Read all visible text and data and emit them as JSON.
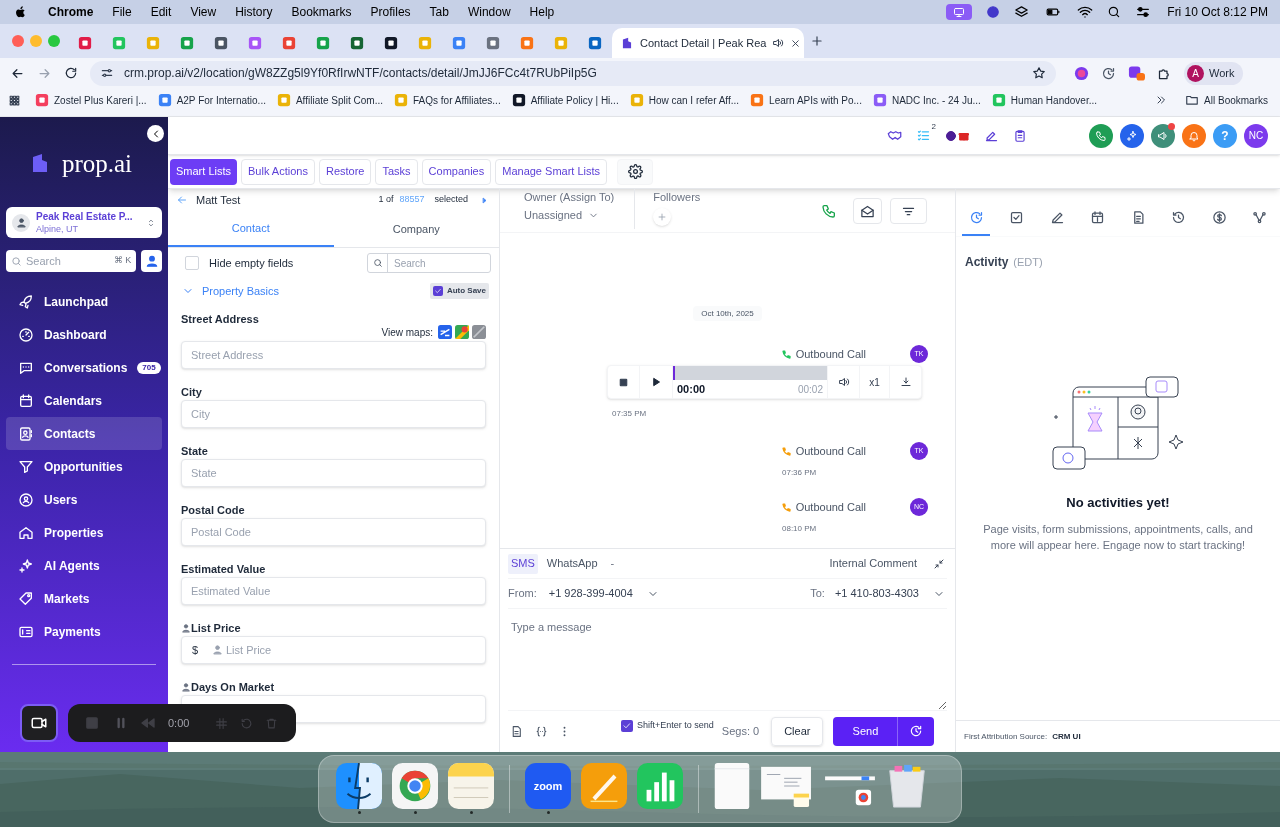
{
  "menu_bar": {
    "app": "Chrome",
    "menus": [
      "File",
      "Edit",
      "View",
      "History",
      "Bookmarks",
      "Profiles",
      "Tab",
      "Window",
      "Help"
    ],
    "clock": "Fri 10 Oct 8:12 PM"
  },
  "browser": {
    "tabs": [
      {
        "selected": false,
        "audio": false
      },
      {
        "selected": false,
        "audio": false
      },
      {
        "selected": false,
        "audio": false
      },
      {
        "selected": false,
        "audio": false
      },
      {
        "selected": false,
        "audio": false
      },
      {
        "selected": false,
        "audio": false
      },
      {
        "selected": false,
        "audio": false
      },
      {
        "selected": false,
        "audio": false
      },
      {
        "selected": false,
        "audio": false
      },
      {
        "selected": false,
        "audio": false
      },
      {
        "selected": false,
        "audio": false
      },
      {
        "selected": false,
        "audio": false
      },
      {
        "selected": false,
        "audio": false
      },
      {
        "selected": false,
        "audio": false
      },
      {
        "selected": false,
        "audio": false
      },
      {
        "selected": false,
        "audio": false
      },
      {
        "title": "Contact Detail | Peak Rea",
        "selected": true,
        "audio": true
      }
    ],
    "url": "crm.prop.ai/v2/location/gW8ZZg5l9Yf0RfIrwNTF/contacts/detail/JmJJ6FCc4t7RUbPiIp5G",
    "profile": {
      "initial": "A",
      "label": "Work"
    },
    "bookmarks": [
      "Zostel Plus Kareri |...",
      "A2P For Internatio...",
      "Affiliate Split Com...",
      "FAQs for Affiliates...",
      "Affiliate Policy | Hi...",
      "How can I refer Aff...",
      "Learn APIs with Po...",
      "NADC Inc. - 24 Ju...",
      "Human Handover..."
    ],
    "all_bookmarks": "All Bookmarks"
  },
  "sidebar": {
    "logo": "prop.ai",
    "location": {
      "name": "Peak Real Estate P...",
      "place": "Alpine, UT"
    },
    "search": {
      "placeholder": "Search",
      "shortcut": "⌘ K"
    },
    "items": [
      {
        "label": "Launchpad",
        "selected": false
      },
      {
        "label": "Dashboard",
        "selected": false
      },
      {
        "label": "Conversations",
        "selected": false,
        "badge": "705"
      },
      {
        "label": "Calendars",
        "selected": false
      },
      {
        "label": "Contacts",
        "selected": true
      },
      {
        "label": "Opportunities",
        "selected": false
      },
      {
        "label": "Users",
        "selected": false
      },
      {
        "label": "Properties",
        "selected": false
      },
      {
        "label": "AI Agents",
        "selected": false
      },
      {
        "label": "Markets",
        "selected": false
      },
      {
        "label": "Payments",
        "selected": false
      }
    ]
  },
  "header": {
    "tasks_badge": "2",
    "announcement_unread": true,
    "help": "?",
    "avatar": "NC"
  },
  "toolbar": [
    {
      "label": "Smart Lists",
      "selected": true
    },
    {
      "label": "Bulk Actions",
      "selected": false
    },
    {
      "label": "Restore",
      "selected": false
    },
    {
      "label": "Tasks",
      "selected": false
    },
    {
      "label": "Companies",
      "selected": false
    },
    {
      "label": "Manage Smart Lists",
      "selected": false
    }
  ],
  "contact": {
    "name": "Matt Test",
    "position": "1 of",
    "total": "88557",
    "selected_label": "selected",
    "tabs": [
      {
        "label": "Contact",
        "selected": true
      },
      {
        "label": "Company",
        "selected": false
      }
    ],
    "hide_empty": {
      "label": "Hide empty fields",
      "checked": false
    },
    "search": {
      "placeholder": "Search"
    },
    "section": {
      "title": "Property Basics",
      "expanded": true
    },
    "auto_save": {
      "label": "Auto Save",
      "checked": true
    },
    "fields": [
      {
        "kind": "standard",
        "label": "Street Address",
        "placeholder": "Street Address",
        "maps_label": "View maps:"
      },
      {
        "kind": "standard",
        "label": "City",
        "placeholder": "City"
      },
      {
        "kind": "standard",
        "label": "State",
        "placeholder": "State"
      },
      {
        "kind": "standard",
        "label": "Postal Code",
        "placeholder": "Postal Code"
      },
      {
        "kind": "standard",
        "label": "Estimated Value",
        "placeholder": "Estimated Value"
      },
      {
        "kind": "custom",
        "label": "List Price",
        "placeholder": "List Price",
        "prefix": "$"
      },
      {
        "kind": "custom",
        "label": "Days On Market"
      }
    ]
  },
  "conversation": {
    "owner": {
      "label": "Owner (Assign To)",
      "value": "Unassigned"
    },
    "followers_label": "Followers",
    "date": "Oct 10th, 2025",
    "messages": [
      {
        "kind": "recording",
        "title": "Outbound Call",
        "avatar": "TK",
        "color": "#22c55e",
        "time": "07:35 PM",
        "elapsed": "00:00",
        "duration": "00:02",
        "speed": "x1",
        "level": 0
      },
      {
        "kind": "call",
        "title": "Outbound Call",
        "avatar": "TK",
        "color": "#f59e0b",
        "time": "07:36 PM"
      },
      {
        "kind": "call",
        "title": "Outbound Call",
        "avatar": "NC",
        "color": "#f59e0b",
        "time": "08:10 PM"
      }
    ]
  },
  "composer": {
    "channels": [
      {
        "label": "SMS",
        "selected": true
      },
      {
        "label": "WhatsApp",
        "selected": false
      }
    ],
    "separator": "-",
    "internal_comment": "Internal Comment",
    "from": {
      "label": "From:",
      "value": "+1 928-399-4004"
    },
    "to": {
      "label": "To:",
      "value": "+1 410-803-4303"
    },
    "placeholder": "Type a message",
    "shift_enter": {
      "label": "Shift+Enter to send",
      "checked": true
    },
    "segments": "Segs: 0",
    "clear": "Clear",
    "send": "Send"
  },
  "activity": {
    "tabs": [
      {
        "selected": true
      },
      {
        "selected": false
      },
      {
        "selected": false
      },
      {
        "selected": false
      },
      {
        "selected": false
      },
      {
        "selected": false
      },
      {
        "selected": false
      },
      {
        "selected": false
      }
    ],
    "title": "Activity",
    "zone": "(EDT)",
    "empty_title": "No activities yet!",
    "empty_text": "Page visits, form submissions, appointments, calls, and more will appear here. Engage now to start tracking!",
    "attribution_label": "First Attribution Source:",
    "attribution_value": "CRM UI"
  },
  "recorder": {
    "time": "0:00"
  },
  "dock": {
    "sections": [
      {
        "items": [
          {
            "kind": "finder",
            "running": true
          },
          {
            "kind": "chrome",
            "running": true
          },
          {
            "kind": "notes",
            "running": true
          }
        ]
      },
      {
        "items": [
          {
            "kind": "zoom",
            "label": "zoom",
            "running": true
          },
          {
            "kind": "pages",
            "running": false
          },
          {
            "kind": "numbers",
            "running": false
          }
        ]
      },
      {
        "items": [
          {
            "kind": "document",
            "running": false
          },
          {
            "kind": "preview",
            "running": false
          },
          {
            "kind": "window",
            "running": false
          },
          {
            "kind": "trash",
            "running": false
          }
        ]
      }
    ]
  }
}
